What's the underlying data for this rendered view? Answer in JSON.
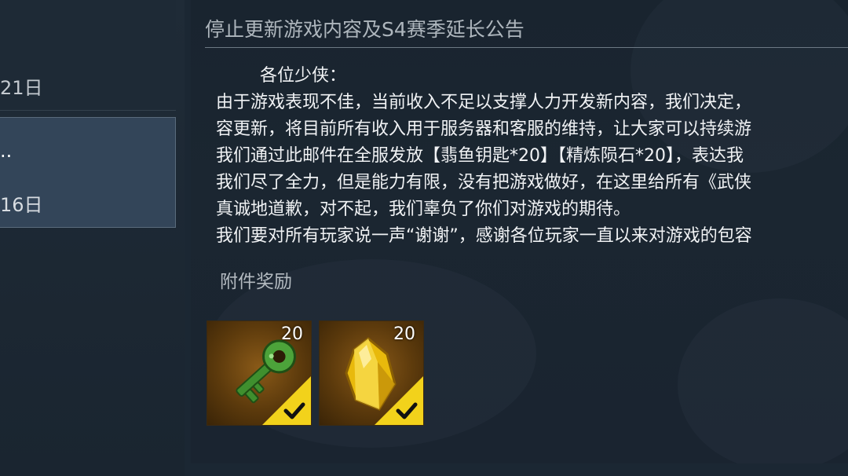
{
  "mail_list": {
    "items": [
      {
        "date": "21日"
      },
      {
        "title": "..",
        "date": "16日"
      }
    ]
  },
  "detail": {
    "title": "停止更新游戏内容及S4赛季延长公告",
    "greeting": "各位少侠：",
    "body_lines": [
      "由于游戏表现不佳，当前收入不足以支撑人力开发新内容，我们决定，",
      "容更新，将目前所有收入用于服务器和客服的维持，让大家可以持续游",
      "我们通过此邮件在全服发放【翡鱼钥匙*20】【精炼陨石*20】，表达我",
      "我们尽了全力，但是能力有限，没有把游戏做好，在这里给所有《武侠",
      "真诚地道歉，对不起，我们辜负了你们对游戏的期待。",
      "我们要对所有玩家说一声“谢谢”，感谢各位玩家一直以来对游戏的包容"
    ],
    "attachment_label": "附件奖励",
    "rewards": [
      {
        "icon": "jade-key-icon",
        "count": "20",
        "claimed": true
      },
      {
        "icon": "gold-crystal-icon",
        "count": "20",
        "claimed": true
      }
    ]
  },
  "colors": {
    "background": "#1b2733",
    "selected_item": "#334559",
    "reward_bg": "#5c3a0c",
    "claimed_badge": "#f2d21b"
  }
}
